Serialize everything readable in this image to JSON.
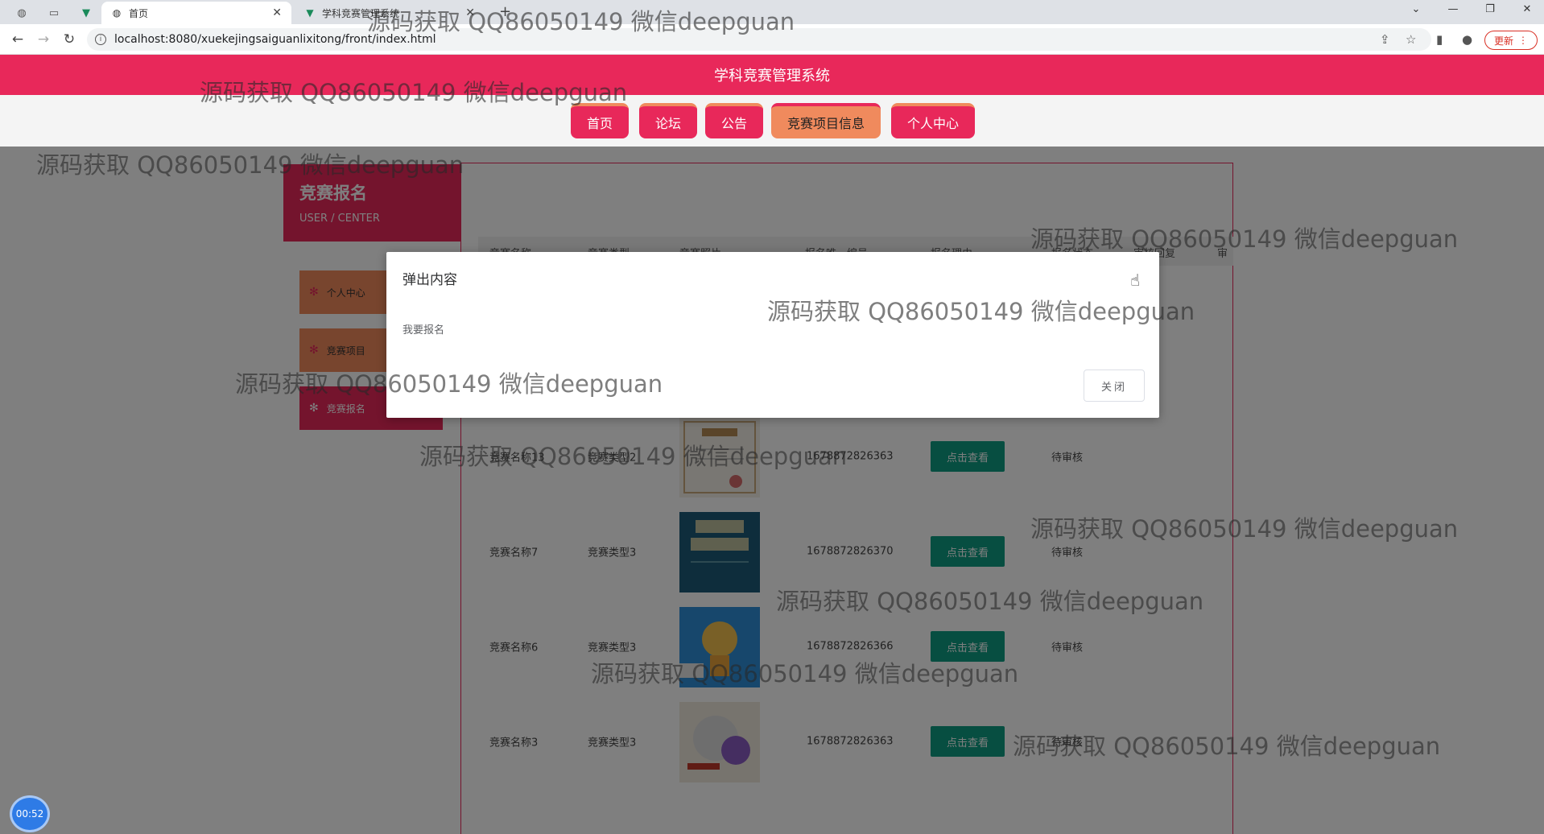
{
  "browser": {
    "tabs": [
      {
        "label": "首页",
        "active": true
      },
      {
        "label": "学科竞赛管理系统",
        "active": false
      }
    ],
    "address": "localhost:8080/xuekejingsaiguanlixitong/front/index.html",
    "update_label": "更新",
    "window_controls": [
      "⌄",
      "—",
      "❐",
      "✕"
    ]
  },
  "site": {
    "title": "学科竞赛管理系统",
    "nav": [
      {
        "label": "首页",
        "active": false
      },
      {
        "label": "论坛",
        "active": false
      },
      {
        "label": "公告",
        "active": false
      },
      {
        "label": "竞赛项目信息",
        "active": true
      },
      {
        "label": "个人中心",
        "active": false
      }
    ]
  },
  "sidebar": {
    "title": "竞赛报名",
    "subtitle": "USER / CENTER",
    "items": [
      {
        "label": "个人中心",
        "active": false
      },
      {
        "label": "竞赛项目",
        "active": false
      },
      {
        "label": "竞赛报名",
        "active": true
      }
    ]
  },
  "table": {
    "headers": [
      "竞赛名称",
      "竞赛类型",
      "竞赛照片",
      "报名唯一编号",
      "报名理由",
      "报名状态",
      "审核回复",
      "审"
    ],
    "view_label": "点击查看",
    "rows": [
      {
        "name": "竞赛名称13",
        "type": "竞赛类型2",
        "code": "1678872826363",
        "status": "待审核"
      },
      {
        "name": "竞赛名称7",
        "type": "竞赛类型3",
        "code": "1678872826370",
        "status": "待审核"
      },
      {
        "name": "竞赛名称6",
        "type": "竞赛类型3",
        "code": "1678872826366",
        "status": "待审核"
      },
      {
        "name": "竞赛名称3",
        "type": "竞赛类型3",
        "code": "1678872826363",
        "status": "待审核"
      }
    ]
  },
  "dialog": {
    "title": "弹出内容",
    "body": "我要报名",
    "close_label": "关闭"
  },
  "watermark_text": "源码获取 QQ86050149 微信deepguan",
  "timer": "00:52"
}
